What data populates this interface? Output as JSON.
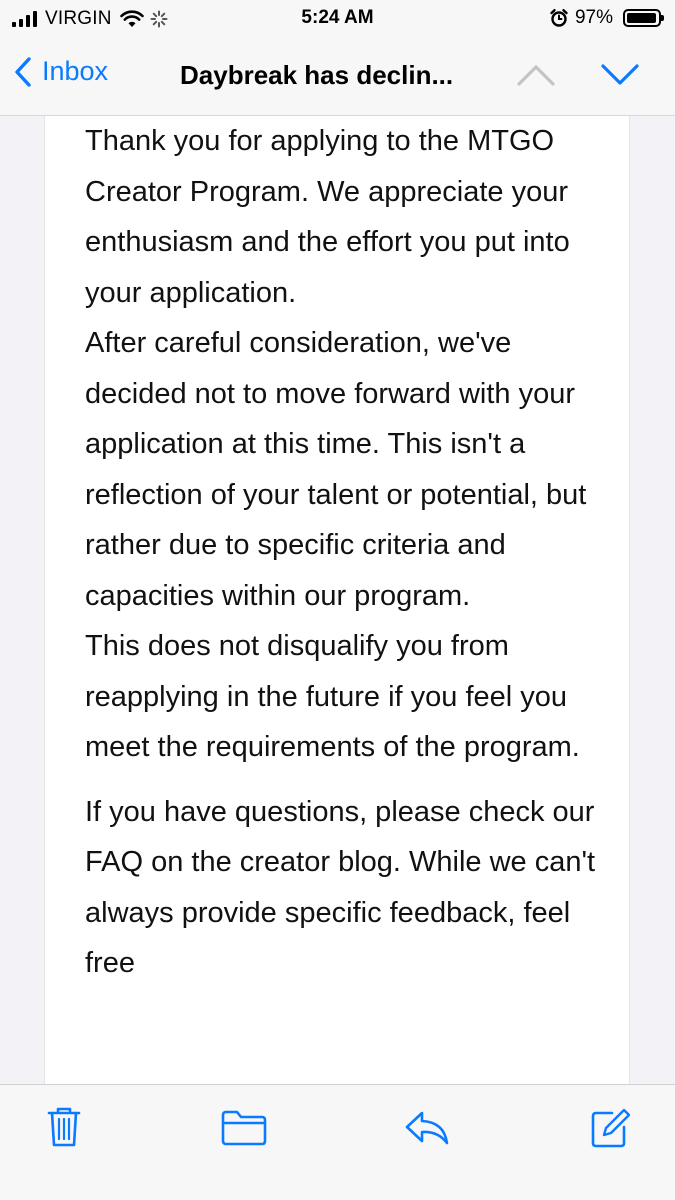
{
  "status_bar": {
    "carrier": "VIRGIN",
    "time": "5:24 AM",
    "battery_percent": "97%",
    "battery_level": 0.97,
    "icons": [
      "signal-icon",
      "wifi-icon",
      "activity-spinner-icon",
      "alarm-icon",
      "battery-icon"
    ]
  },
  "nav": {
    "back_label": "Inbox",
    "title": "Daybreak has declin...",
    "up_icon": "chevron-up-icon",
    "down_icon": "chevron-down-icon"
  },
  "email": {
    "paragraphs": [
      "Thank you for applying to the MTGO Creator Program. We appreciate your enthusiasm and the effort you put into your application.",
      "After careful consideration, we've decided not to move forward with your application at this time. This isn't a reflection of your talent or potential, but rather due to specific criteria and capacities within our program.",
      "This does not disqualify you from reapplying in the future if you feel you meet the requirements of the program.",
      "If you have questions, please check our FAQ on the creator blog. While we can't always provide specific feedback, feel free"
    ]
  },
  "toolbar": {
    "icons": [
      "trash-icon",
      "folder-icon",
      "reply-icon",
      "compose-icon"
    ]
  },
  "colors": {
    "accent": "#0a7aff",
    "bar_background": "#f7f7f7",
    "page_background": "#f2f2f7",
    "card_background": "#ffffff",
    "text": "#111111"
  }
}
